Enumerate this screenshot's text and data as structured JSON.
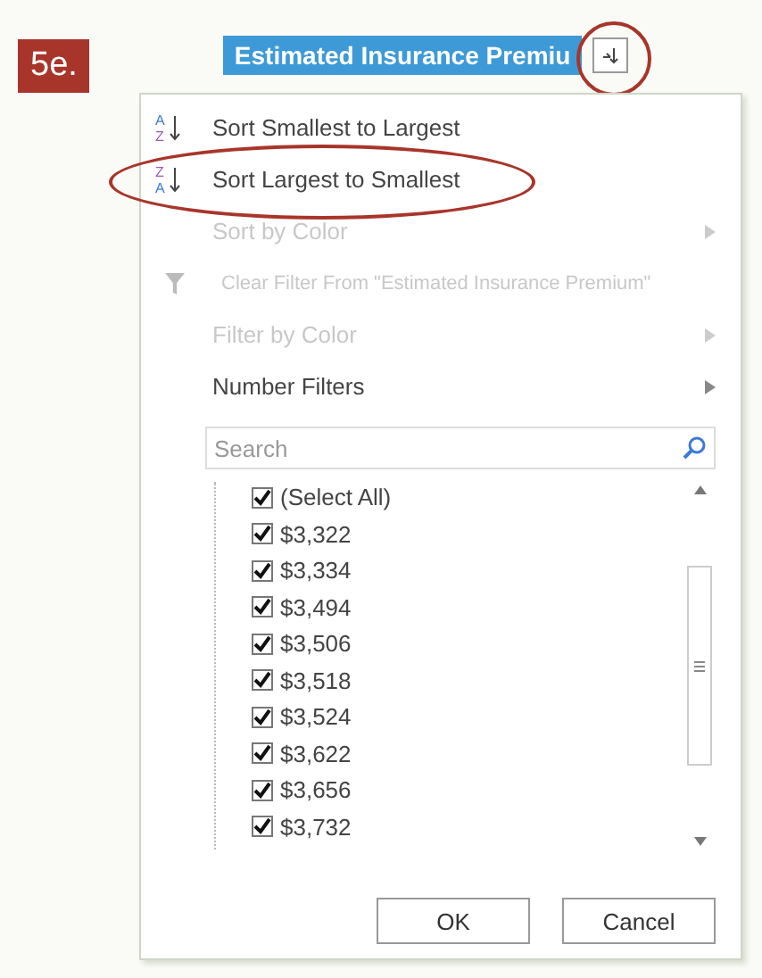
{
  "step_label": "5e.",
  "column_header": {
    "title": "Estimated Insurance Premiu",
    "button_circled": true
  },
  "menu_items": [
    {
      "kind": "sort-ascending",
      "icon_letters": [
        "A",
        "Z"
      ],
      "label": "Sort Smallest to Largest",
      "disabled": false,
      "circled": false,
      "submenu": false
    },
    {
      "kind": "sort-descending",
      "icon_letters": [
        "Z",
        "A"
      ],
      "label": "Sort Largest to Smallest",
      "disabled": false,
      "circled": true,
      "submenu": false
    },
    {
      "kind": "plain",
      "label": "Sort by Color",
      "disabled": true,
      "circled": false,
      "submenu": true
    },
    {
      "kind": "clear-filter",
      "label": "Clear Filter From \"Estimated Insurance Premium\"",
      "disabled": true,
      "circled": false,
      "submenu": false
    },
    {
      "kind": "plain",
      "label": "Filter by Color",
      "disabled": true,
      "circled": false,
      "submenu": true
    },
    {
      "kind": "plain",
      "label": "Number Filters",
      "disabled": false,
      "circled": false,
      "submenu": true
    }
  ],
  "search": {
    "placeholder": "Search"
  },
  "values": [
    {
      "label": "(Select All)",
      "checked": true
    },
    {
      "label": "$3,322",
      "checked": true
    },
    {
      "label": "$3,334",
      "checked": true
    },
    {
      "label": "$3,494",
      "checked": true
    },
    {
      "label": "$3,506",
      "checked": true
    },
    {
      "label": "$3,518",
      "checked": true
    },
    {
      "label": "$3,524",
      "checked": true
    },
    {
      "label": "$3,622",
      "checked": true
    },
    {
      "label": "$3,656",
      "checked": true
    },
    {
      "label": "$3,732",
      "checked": true
    }
  ],
  "buttons": [
    "OK",
    "Cancel"
  ]
}
